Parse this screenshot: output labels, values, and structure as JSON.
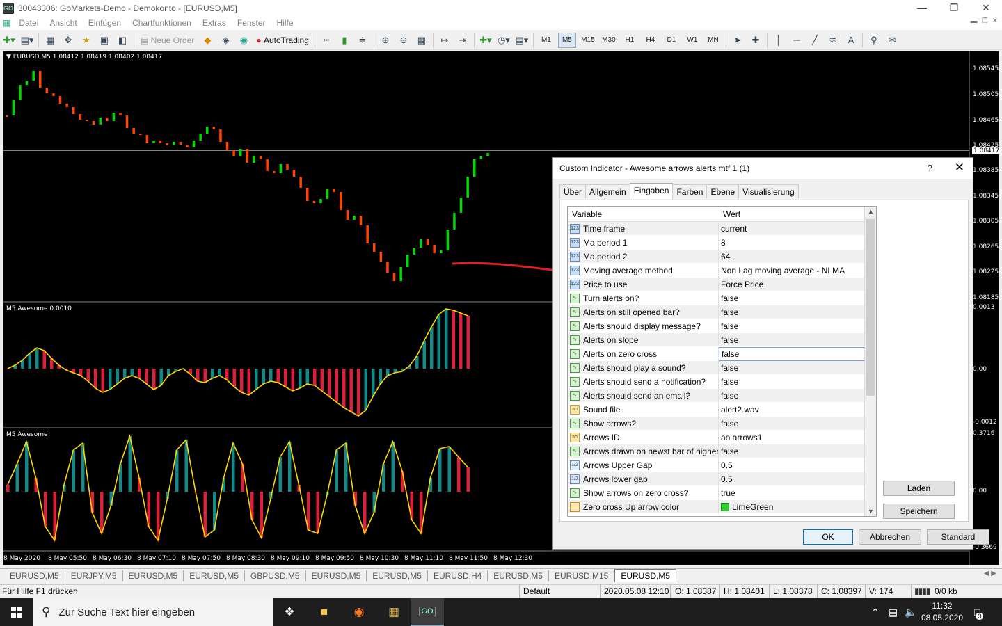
{
  "window": {
    "title": "30043306: GoMarkets-Demo - Demokonto - [EURUSD,M5]",
    "app_icon": "GO"
  },
  "menu": [
    "Datei",
    "Ansicht",
    "Einfügen",
    "Chartfunktionen",
    "Extras",
    "Fenster",
    "Hilfe"
  ],
  "toolbar": {
    "new_order": "Neue Order",
    "autotrading": "AutoTrading",
    "timeframes": [
      "M1",
      "M5",
      "M15",
      "M30",
      "H1",
      "H4",
      "D1",
      "W1",
      "MN"
    ],
    "selected_tf": "M5",
    "text_tool": "A"
  },
  "chart": {
    "symbol_info": "EURUSD,M5  1.08412 1.08419 1.08402 1.08417",
    "current_price": "1.08417",
    "price_labels": [
      "1.08545",
      "1.08505",
      "1.08465",
      "1.08425",
      "1.08385",
      "1.08345",
      "1.08305",
      "1.08265",
      "1.08225",
      "1.08185"
    ],
    "ind1_label": "M5 Awesome 0.0010",
    "ind1_scale": [
      "0.0013",
      "0.00",
      "-0.0012"
    ],
    "ind2_label": "M5 Awesome",
    "ind2_scale": [
      "0.3716",
      "0.00",
      "-0.3669"
    ],
    "time_labels": [
      "8 May 2020",
      "8 May 05:50",
      "8 May 06:30",
      "8 May 07:10",
      "8 May 07:50",
      "8 May 08:30",
      "8 May 09:10",
      "8 May 09:50",
      "8 May 10:30",
      "8 May 11:10",
      "8 May 11:50",
      "8 May 12:30"
    ],
    "colors": {
      "bull": "#00dd00",
      "bear": "#ff4500",
      "ao_up": "#138a8a",
      "ao_down": "#e0203a",
      "ao_line": "#ffd700",
      "annotation": "#e02020"
    }
  },
  "chart_tabs": [
    "EURUSD,M5",
    "EURJPY,M5",
    "EURUSD,M5",
    "EURUSD,M5",
    "GBPUSD,M5",
    "EURUSD,M5",
    "EURUSD,M5",
    "EURUSD,H4",
    "EURUSD,M5",
    "EURUSD,M15",
    "EURUSD,M5"
  ],
  "active_tab": 10,
  "status": {
    "help": "Für Hilfe F1 drücken",
    "profile": "Default",
    "datetime": "2020.05.08 12:10",
    "open": "O: 1.08387",
    "high": "H: 1.08401",
    "low": "L: 1.08378",
    "close": "C: 1.08397",
    "volume": "V: 174",
    "traffic": "0/0 kb"
  },
  "taskbar": {
    "search_placeholder": "Zur Suche Text hier eingeben",
    "time": "11:32",
    "date": "08.05.2020",
    "notifications": "3"
  },
  "dialog": {
    "title": "Custom Indicator - Awesome arrows alerts mtf 1 (1)",
    "help": "?",
    "tabs": [
      "Über",
      "Allgemein",
      "Eingaben",
      "Farben",
      "Ebene",
      "Visualisierung"
    ],
    "active_tab": 2,
    "col_variable": "Variable",
    "col_value": "Wert",
    "rows": [
      {
        "type": "num",
        "icon": "123",
        "name": "Time frame",
        "value": "current"
      },
      {
        "type": "num",
        "icon": "123",
        "name": "Ma period 1",
        "value": "8"
      },
      {
        "type": "num",
        "icon": "123",
        "name": "Ma period 2",
        "value": "64"
      },
      {
        "type": "num",
        "icon": "123",
        "name": "Moving average method",
        "value": "Non Lag moving average - NLMA"
      },
      {
        "type": "num",
        "icon": "123",
        "name": "Price to use",
        "value": "Force Price"
      },
      {
        "type": "bool",
        "icon": "bool-icon",
        "name": "Turn alerts on?",
        "value": "false"
      },
      {
        "type": "bool",
        "icon": "bool-icon",
        "name": "Alerts on still opened bar?",
        "value": "false"
      },
      {
        "type": "bool",
        "icon": "bool-icon",
        "name": "Alerts should display message?",
        "value": "false"
      },
      {
        "type": "bool",
        "icon": "bool-icon",
        "name": "Alerts on slope",
        "value": "false"
      },
      {
        "type": "bool",
        "icon": "bool-icon",
        "name": "Alerts on zero cross",
        "value": "false"
      },
      {
        "type": "bool",
        "icon": "bool-icon",
        "name": "Alerts should play a sound?",
        "value": "false"
      },
      {
        "type": "bool",
        "icon": "bool-icon",
        "name": "Alerts should send a notification?",
        "value": "false"
      },
      {
        "type": "bool",
        "icon": "bool-icon",
        "name": "Alerts should send an email?",
        "value": "false"
      },
      {
        "type": "str",
        "icon": "ab",
        "name": "Sound file",
        "value": "alert2.wav"
      },
      {
        "type": "bool",
        "icon": "bool-icon",
        "name": "Show arrows?",
        "value": "false"
      },
      {
        "type": "str",
        "icon": "ab",
        "name": "Arrows ID",
        "value": "ao arrows1"
      },
      {
        "type": "bool",
        "icon": "bool-icon",
        "name": "Arrows drawn on newst bar of higher ti...",
        "value": "false"
      },
      {
        "type": "dbl",
        "icon": "1/2",
        "name": "Arrows Upper Gap",
        "value": "0.5"
      },
      {
        "type": "dbl",
        "icon": "1/2",
        "name": "Arrows lower gap",
        "value": "0.5"
      },
      {
        "type": "bool",
        "icon": "bool-icon",
        "name": "Show arrows on zero cross?",
        "value": "true"
      },
      {
        "type": "col",
        "icon": "color-icon",
        "name": "Zero cross Up arrow color",
        "value": "LimeGreen"
      }
    ],
    "selected_row": 9,
    "buttons": {
      "load": "Laden",
      "save": "Speichern",
      "ok": "OK",
      "cancel": "Abbrechen",
      "standard": "Standard"
    }
  }
}
